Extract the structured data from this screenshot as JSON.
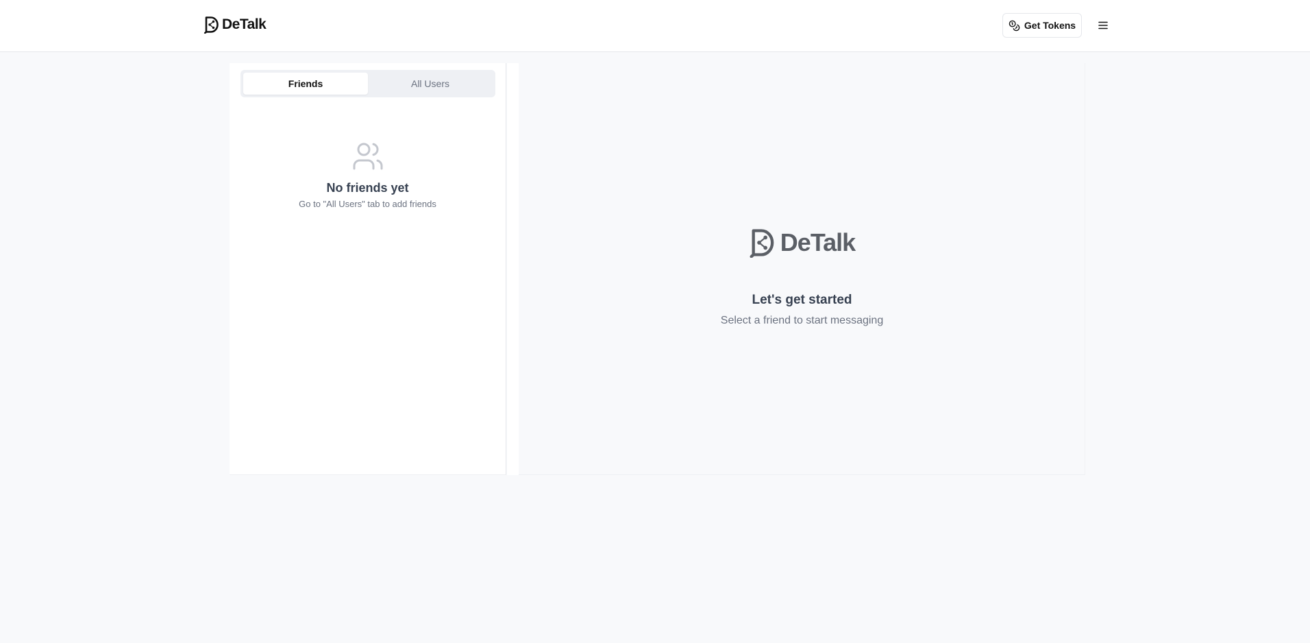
{
  "header": {
    "brand": "DeTalk",
    "get_tokens_label": "Get Tokens",
    "icons": {
      "brand": "detalk-logo-icon",
      "tokens": "coins-icon",
      "menu": "hamburger-menu-icon"
    }
  },
  "sidebar": {
    "tabs": [
      {
        "label": "Friends",
        "active": true
      },
      {
        "label": "All Users",
        "active": false
      }
    ],
    "empty_state": {
      "icon": "users-icon",
      "title": "No friends yet",
      "subtitle": "Go to \"All Users\" tab to add friends"
    }
  },
  "chat": {
    "logo_text": "DeTalk",
    "title": "Let's get started",
    "subtitle": "Select a friend to start messaging"
  },
  "colors": {
    "background": "#f8f9fb",
    "surface": "#ffffff",
    "tab_track": "#eef0f4",
    "text_primary": "#111111",
    "text_muted": "#6b7280",
    "logo_gray": "#5b5f66"
  }
}
